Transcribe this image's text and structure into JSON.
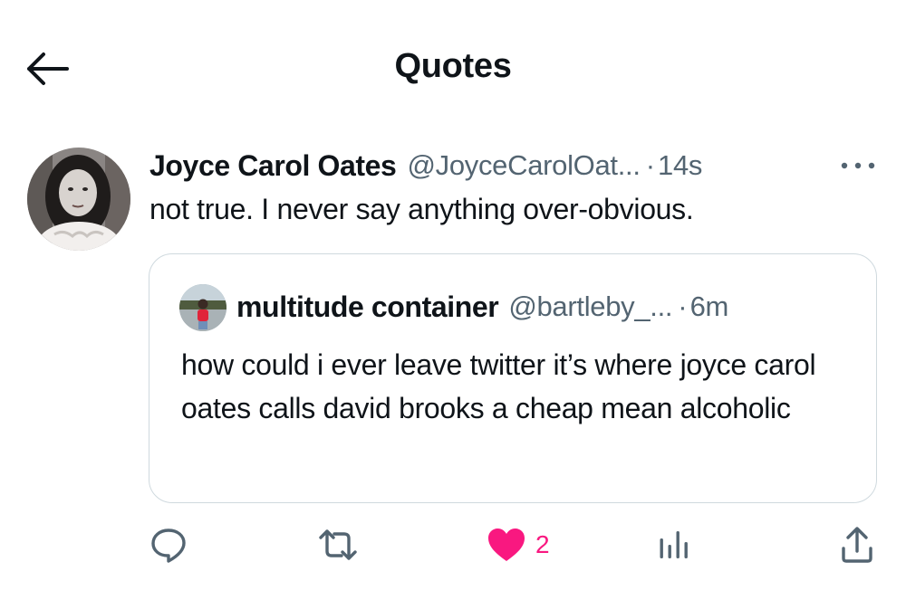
{
  "header": {
    "title": "Quotes",
    "back_icon": "arrow-left-icon"
  },
  "tweet": {
    "author_name": "Joyce Carol Oates",
    "author_handle": "@JoyceCarolOat...",
    "separator": "·",
    "timestamp": "14s",
    "text": "not true. I never say anything over-obvious.",
    "more_icon": "more-horizontal-icon"
  },
  "quoted_tweet": {
    "author_name": "multitude container",
    "author_handle": "@bartleby_...",
    "separator": "·",
    "timestamp": "6m",
    "text": "how could i ever leave twitter it’s where joyce carol oates calls david brooks a cheap mean alcoholic"
  },
  "actions": {
    "reply_icon": "reply-icon",
    "retweet_icon": "retweet-icon",
    "like_icon": "heart-filled-icon",
    "like_count": "2",
    "like_color": "#f91880",
    "views_icon": "analytics-icon",
    "share_icon": "share-icon"
  },
  "colors": {
    "text": "#0f1419",
    "secondary": "#536471",
    "border": "#cfd9de",
    "like": "#f91880"
  }
}
